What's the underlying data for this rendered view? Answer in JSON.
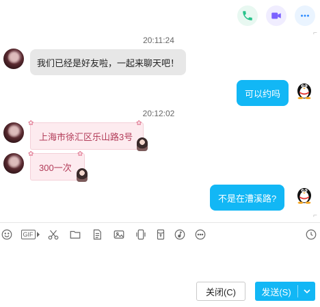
{
  "header": {
    "call_icon": "phone-icon",
    "video_icon": "video-icon",
    "more_icon": "more-icon",
    "colors": {
      "call": "#27c28a",
      "video": "#7b61ff",
      "more": "#2f8cff"
    }
  },
  "chat": {
    "messages": [
      {
        "type": "timestamp",
        "text": "20:11:24"
      },
      {
        "type": "incoming",
        "text": "我们已经是好友啦，一起来聊天吧！"
      },
      {
        "type": "outgoing",
        "text": "可以约吗"
      },
      {
        "type": "timestamp",
        "text": "20:12:02"
      },
      {
        "type": "incoming_card",
        "text": "上海市徐汇区乐山路3号"
      },
      {
        "type": "incoming_card",
        "text": "300一次"
      },
      {
        "type": "outgoing",
        "text": "不是在漕溪路?"
      }
    ]
  },
  "toolbar": {
    "items": [
      "emoji-icon",
      "gif-icon",
      "scissors-icon",
      "folder-icon",
      "doc-icon",
      "image-icon",
      "shake-icon",
      "red-packet-icon",
      "music-icon",
      "more-icon",
      "history-icon"
    ],
    "gif_label": "GIF"
  },
  "footer": {
    "close_label": "关闭(C)",
    "send_label": "发送(S)"
  },
  "colors": {
    "accent": "#12b7f5",
    "pink_bg": "#fdebef",
    "pink_text": "#b23b58"
  }
}
